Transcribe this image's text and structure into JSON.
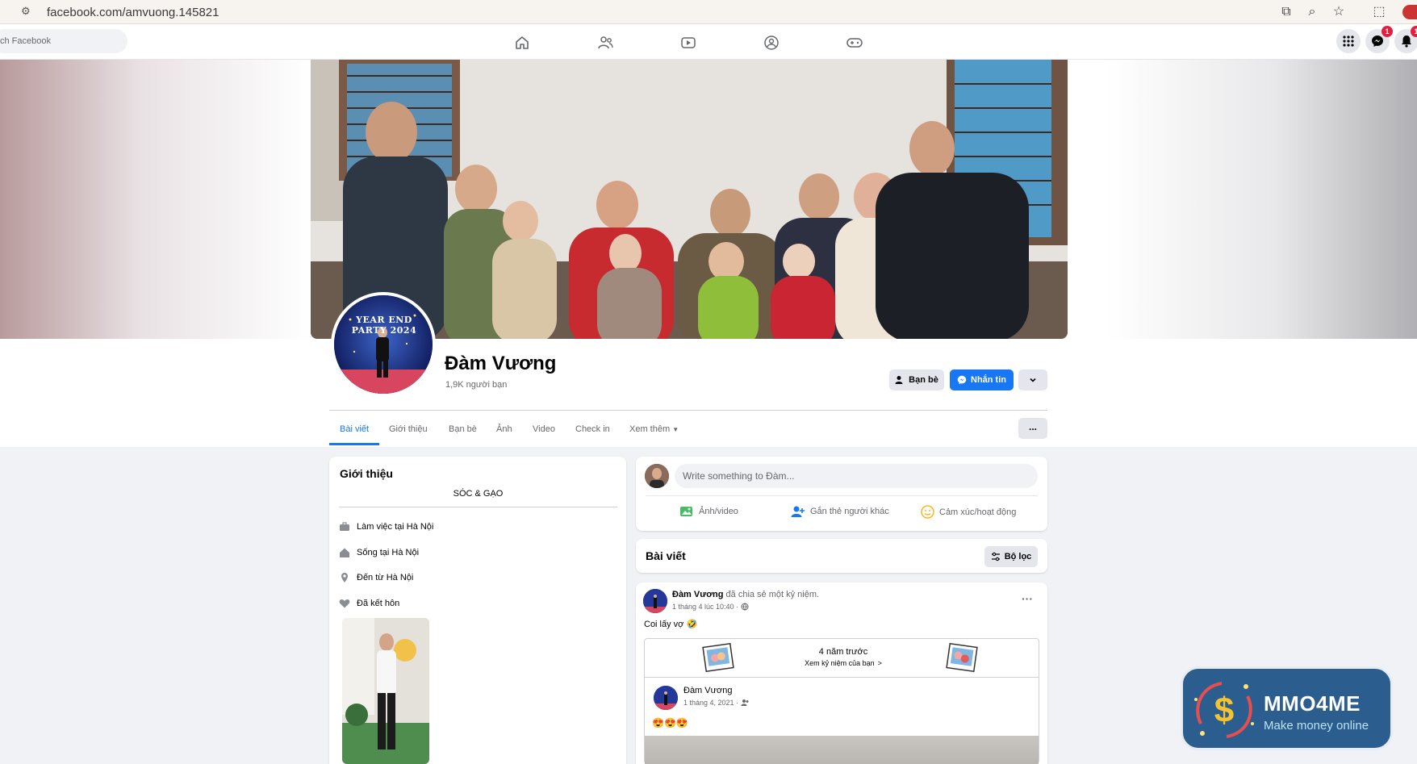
{
  "browser": {
    "url": "facebook.com/amvuong.145821",
    "toolbar_icons": [
      "install-icon",
      "zoom-icon",
      "star-icon",
      "extensions-icon",
      "profile-icon"
    ]
  },
  "fb_header": {
    "search_placeholder": "ch Facebook",
    "nav_icons": [
      "home-icon",
      "friends-icon",
      "watch-icon",
      "groups-icon",
      "gaming-icon"
    ],
    "right_icons": [
      "menu-grid-icon",
      "messenger-icon",
      "notifications-icon"
    ],
    "messenger_badge": "1",
    "notifications_badge": "1"
  },
  "profile": {
    "name": "Đàm Vương",
    "friends_count": "1,9K người bạn",
    "avatar_banner_text": "YEAR END PARTY 2024",
    "buttons": {
      "friends": "Bạn bè",
      "message": "Nhắn tin"
    },
    "tabs": [
      "Bài viết",
      "Giới thiệu",
      "Bạn bè",
      "Ảnh",
      "Video",
      "Check in",
      "Xem thêm"
    ],
    "more_button": "..."
  },
  "intro": {
    "title": "Giới thiệu",
    "bio": "SÓC & GẠO",
    "items": [
      {
        "icon": "briefcase-icon",
        "text": "Làm việc tại Hà Nội"
      },
      {
        "icon": "house-icon",
        "text": "Sống tại Hà Nội"
      },
      {
        "icon": "location-pin-icon",
        "text": "Đến từ Hà Nội"
      },
      {
        "icon": "heart-icon",
        "text": "Đã kết hôn"
      }
    ]
  },
  "composer": {
    "placeholder": "Write something to Đàm...",
    "actions": [
      {
        "icon": "photo-video-icon",
        "label": "Ảnh/video",
        "color": "#45bd62"
      },
      {
        "icon": "tag-people-icon",
        "label": "Gắn thẻ người khác",
        "color": "#1877f2"
      },
      {
        "icon": "feeling-icon",
        "label": "Cảm xúc/hoạt động",
        "color": "#f7b928"
      }
    ]
  },
  "posts_header": {
    "title": "Bài viết",
    "filter_label": "Bộ lọc"
  },
  "post": {
    "author": "Đàm Vương",
    "action": "đã chia sẻ một kỷ niệm.",
    "time": "1 tháng 4 lúc 10:40 ·",
    "text": "Coi lấy vợ 🤣",
    "memory": {
      "title": "4 năm trước",
      "subtitle": "Xem kỷ niệm của bạn",
      "inner_author": "Đàm Vương",
      "inner_time": "1 tháng 4, 2021 ·",
      "inner_text": "😍😍😍"
    }
  },
  "watermark": {
    "brand": "MMO4ME",
    "tagline": "Make money online"
  },
  "colors": {
    "fb_blue": "#1877f2",
    "page_bg": "#f0f2f5",
    "secondary_text": "#65676b"
  }
}
